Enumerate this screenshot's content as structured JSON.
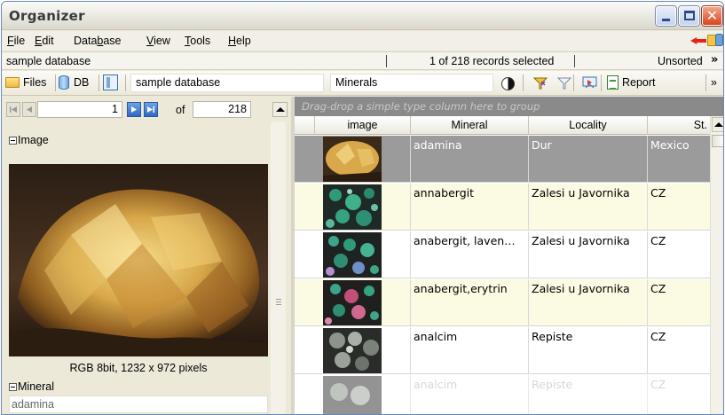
{
  "window": {
    "title": "Organizer"
  },
  "menu": {
    "items": [
      {
        "label": "File",
        "u": "F",
        "rest": "ile"
      },
      {
        "label": "Edit",
        "u": "E",
        "rest": "dit"
      },
      {
        "label": "Database",
        "pre": "Data",
        "u": "b",
        "rest": "ase"
      },
      {
        "label": "View",
        "u": "V",
        "rest": "iew"
      },
      {
        "label": "Tools",
        "u": "T",
        "rest": "ools"
      },
      {
        "label": "Help",
        "u": "H",
        "rest": "elp"
      }
    ]
  },
  "status": {
    "database": "sample database",
    "records": "1 of 218 records selected",
    "sort": "Unsorted",
    "more": "»"
  },
  "toolbar": {
    "files_label": "Files",
    "db_label": "DB",
    "database_combo": "sample database",
    "table_combo": "Minerals",
    "report_label": "Report",
    "more": "»"
  },
  "navigator": {
    "current": "1",
    "of_label": "of",
    "total": "218"
  },
  "detail": {
    "image_group": "Image",
    "image_caption": "RGB 8bit, 1232 x 972 pixels",
    "mineral_group": "Mineral",
    "mineral_value": "adamina"
  },
  "grid": {
    "drag_hint": "Drag-drop a simple type column here to group",
    "columns": [
      "image",
      "Mineral",
      "Locality",
      "St."
    ],
    "rows": [
      {
        "mineral": "adamina",
        "locality": "Dur",
        "state": "Mexico"
      },
      {
        "mineral": "annabergit",
        "locality": "Zalesi u Javornika",
        "state": "CZ"
      },
      {
        "mineral": "anabergit, laven…",
        "locality": "Zalesi u Javornika",
        "state": "CZ"
      },
      {
        "mineral": "anabergit,erytrin",
        "locality": "Zalesi u Javornika",
        "state": "CZ"
      },
      {
        "mineral": "analcim",
        "locality": "Repiste",
        "state": "CZ"
      },
      {
        "mineral": "analcim",
        "locality": "Repiste",
        "state": "CZ"
      }
    ]
  },
  "colors": {
    "selected_row": "#9b9b9b",
    "alt_row": "#fbfae2",
    "drag_hint_bg": "#8a8a8a",
    "close_button": "#d9451d"
  }
}
